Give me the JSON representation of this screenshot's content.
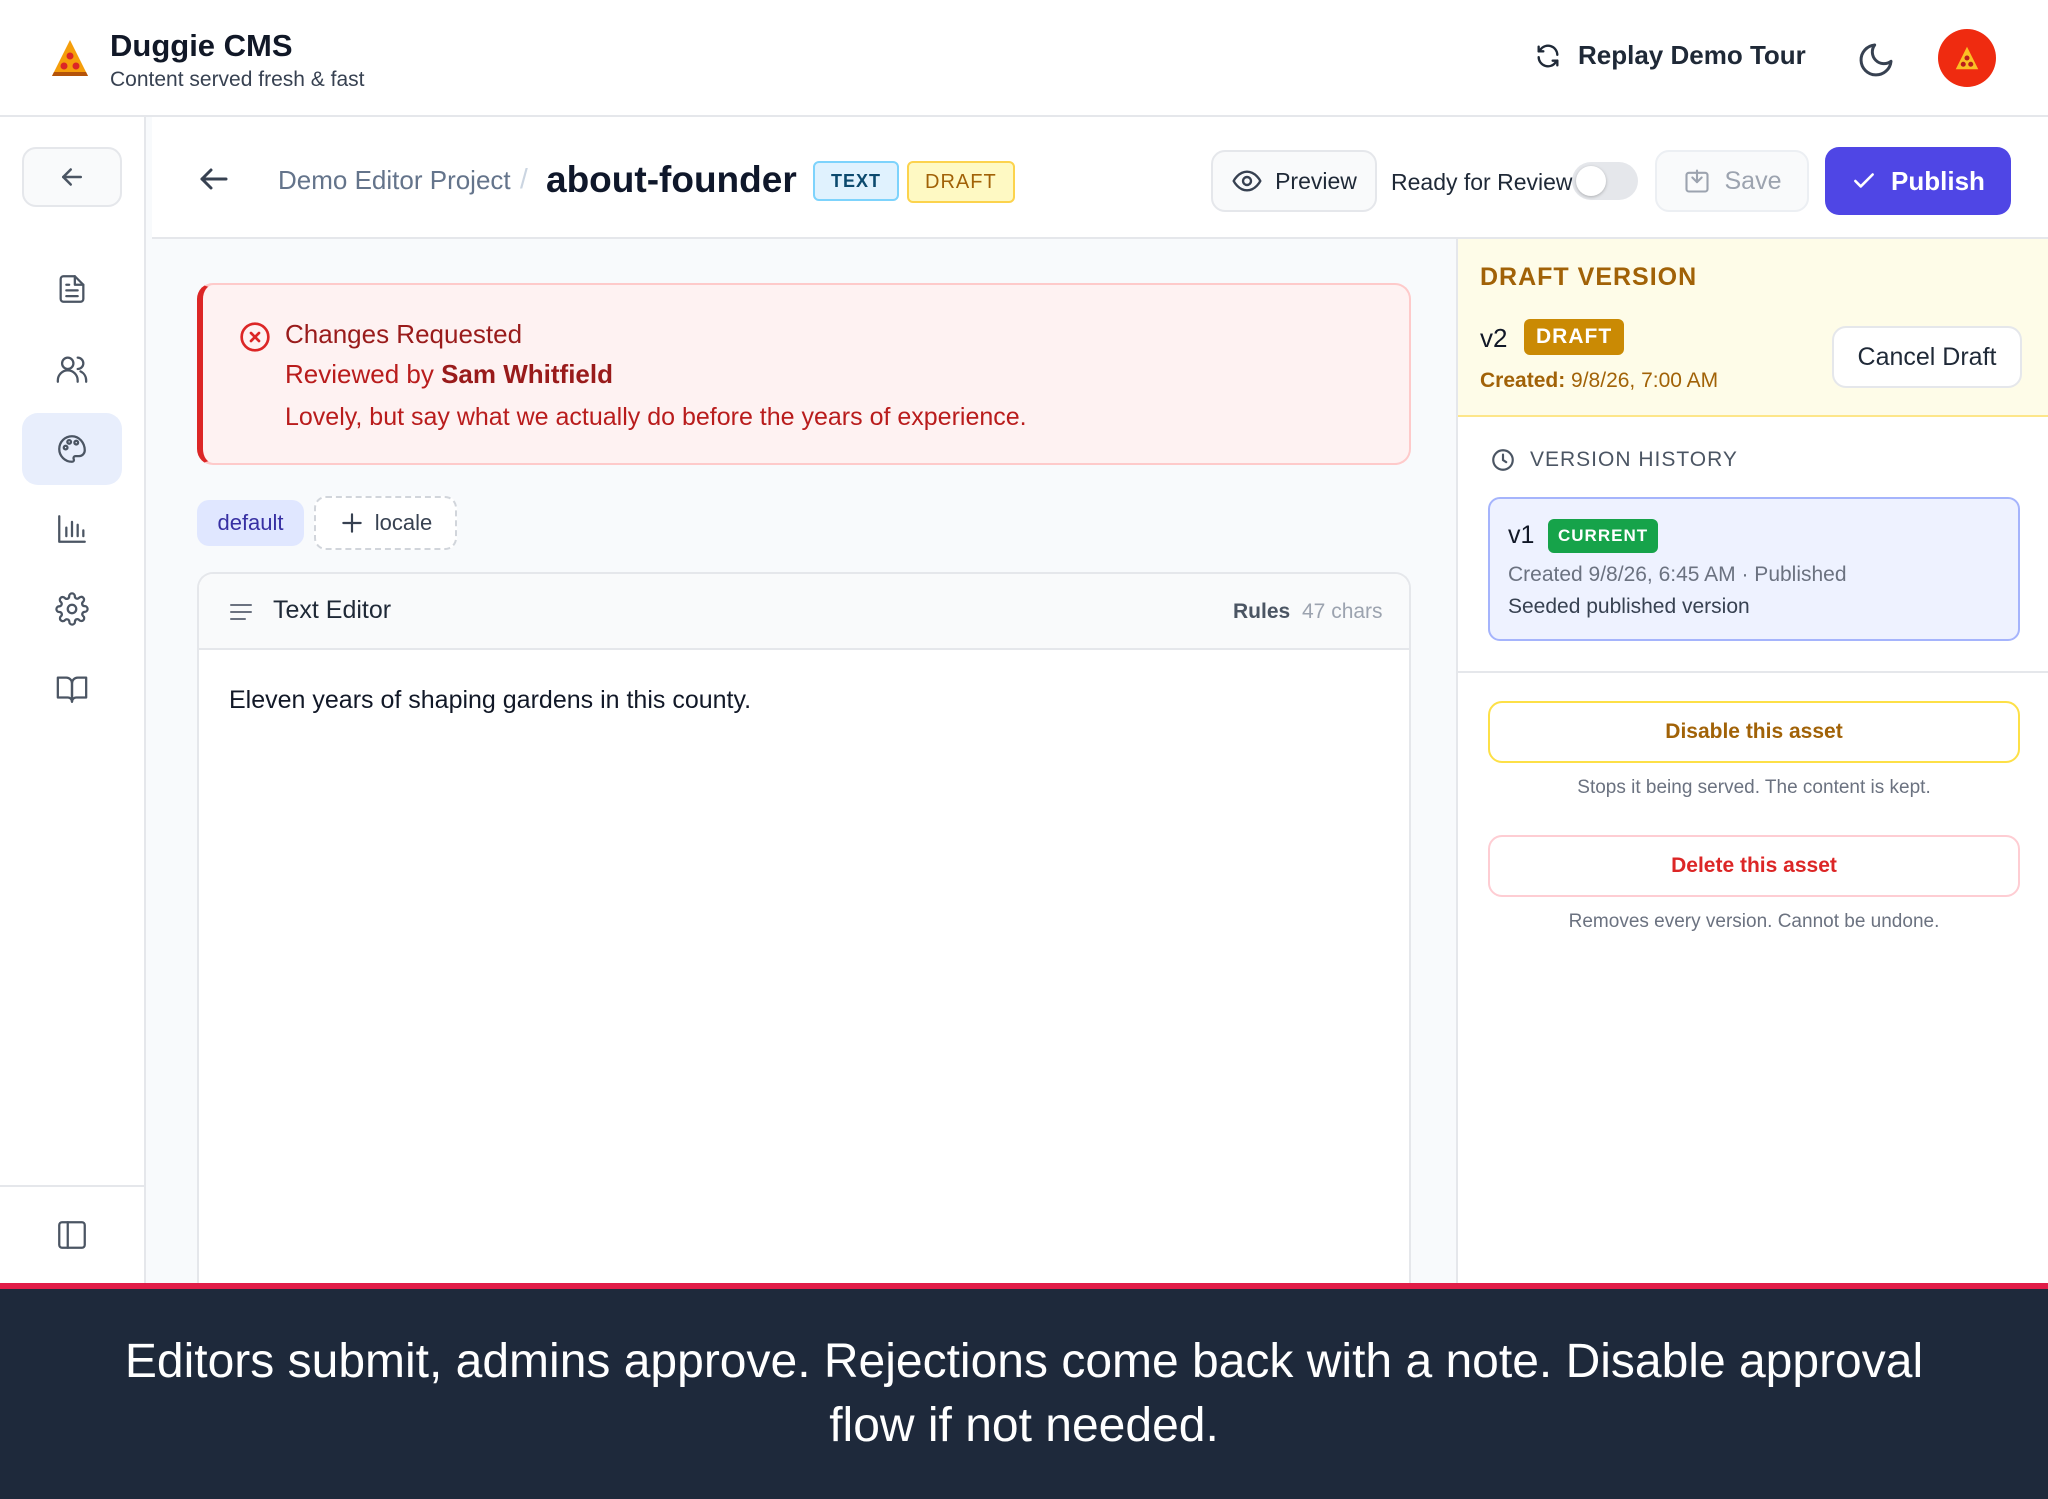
{
  "app": {
    "name": "Duggie CMS",
    "tagline": "Content served fresh & fast",
    "replay_label": "Replay Demo Tour",
    "icons": {
      "logo": "pizza-slice-icon",
      "replay": "refresh-icon",
      "theme": "moon-icon",
      "avatar": "pizza-avatar-icon"
    }
  },
  "sidebar": {
    "items": [
      {
        "name": "collapse",
        "icon": "arrow-left-icon"
      },
      {
        "name": "content",
        "icon": "document-icon"
      },
      {
        "name": "users",
        "icon": "users-icon"
      },
      {
        "name": "themes",
        "icon": "palette-icon",
        "active": true
      },
      {
        "name": "analytics",
        "icon": "bar-chart-icon"
      },
      {
        "name": "settings",
        "icon": "gear-icon"
      },
      {
        "name": "docs",
        "icon": "book-icon"
      },
      {
        "name": "panel",
        "icon": "sidebar-panel-icon"
      }
    ]
  },
  "editor_header": {
    "breadcrumb_project": "Demo Editor Project",
    "separator": "/",
    "asset_name": "about-founder",
    "type_badge": "TEXT",
    "status_badge": "DRAFT",
    "preview_label": "Preview",
    "ready_label": "Ready for Review",
    "ready_on": false,
    "save_label": "Save",
    "publish_label": "Publish"
  },
  "review": {
    "title": "Changes Requested",
    "by_prefix": "Reviewed by",
    "reviewer": "Sam Whitfield",
    "note": "Lovely, but say what we actually do before the years of experience."
  },
  "locales": {
    "current": "default",
    "add_label": "locale"
  },
  "text_editor": {
    "title": "Text Editor",
    "rules_label": "Rules",
    "char_count": "47 chars",
    "content": "Eleven years of shaping gardens in this county."
  },
  "draft": {
    "heading": "DRAFT VERSION",
    "version": "v2",
    "badge": "DRAFT",
    "created_label": "Created:",
    "created_value": "9/8/26, 7:00 AM",
    "cancel_label": "Cancel Draft"
  },
  "history": {
    "heading": "VERSION HISTORY",
    "versions": [
      {
        "version": "v1",
        "badge": "CURRENT",
        "meta": "Created 9/8/26, 6:45 AM · Published",
        "note": "Seeded published version"
      }
    ]
  },
  "danger": {
    "disable_label": "Disable this asset",
    "disable_note": "Stops it being served. The content is kept.",
    "delete_label": "Delete this asset",
    "delete_note": "Removes every version. Cannot be undone."
  },
  "tour": {
    "caption": "Editors submit, admins approve. Rejections come back with a note. Disable approval flow if not needed."
  },
  "colors": {
    "accent": "#4f46e5",
    "danger": "#dc2626",
    "warning": "#ca8a04",
    "success": "#16a34a",
    "caption_bg": "#1e293b"
  }
}
